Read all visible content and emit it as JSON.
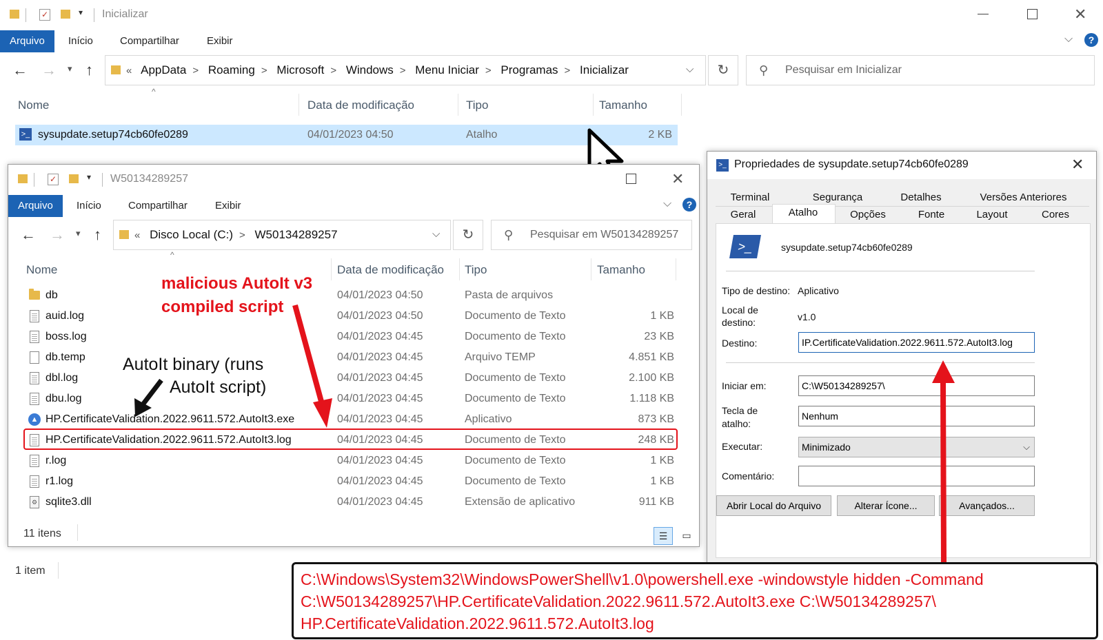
{
  "win1": {
    "title": "Inicializar",
    "ribbon": [
      "Arquivo",
      "Início",
      "Compartilhar",
      "Exibir"
    ],
    "crumbs": [
      "AppData",
      "Roaming",
      "Microsoft",
      "Windows",
      "Menu Iniciar",
      "Programas",
      "Inicializar"
    ],
    "search_placeholder": "Pesquisar em Inicializar",
    "columns": [
      "Nome",
      "Data de modificação",
      "Tipo",
      "Tamanho"
    ],
    "row": {
      "name": "sysupdate.setup74cb60fe0289",
      "date": "04/01/2023 04:50",
      "type": "Atalho",
      "size": "2 KB"
    },
    "status": "1 item"
  },
  "win2": {
    "title": "W50134289257",
    "ribbon": [
      "Arquivo",
      "Início",
      "Compartilhar",
      "Exibir"
    ],
    "crumbs": [
      "Disco Local (C:)",
      "W50134289257"
    ],
    "search_placeholder": "Pesquisar em W50134289257",
    "columns": [
      "Nome",
      "Data de modificação",
      "Tipo",
      "Tamanho"
    ],
    "rows": [
      {
        "name": "db",
        "date": "04/01/2023 04:50",
        "type": "Pasta de arquivos",
        "size": "",
        "icon": "folder-icon"
      },
      {
        "name": "auid.log",
        "date": "04/01/2023 04:50",
        "type": "Documento de Texto",
        "size": "1 KB",
        "icon": "text-file-icon"
      },
      {
        "name": "boss.log",
        "date": "04/01/2023 04:45",
        "type": "Documento de Texto",
        "size": "23 KB",
        "icon": "text-file-icon"
      },
      {
        "name": "db.temp",
        "date": "04/01/2023 04:45",
        "type": "Arquivo TEMP",
        "size": "4.851 KB",
        "icon": "blank-file-icon"
      },
      {
        "name": "dbl.log",
        "date": "04/01/2023 04:45",
        "type": "Documento de Texto",
        "size": "2.100 KB",
        "icon": "text-file-icon"
      },
      {
        "name": "dbu.log",
        "date": "04/01/2023 04:45",
        "type": "Documento de Texto",
        "size": "1.118 KB",
        "icon": "text-file-icon"
      },
      {
        "name": "HP.CertificateValidation.2022.9611.572.AutoIt3.exe",
        "date": "04/01/2023 04:45",
        "type": "Aplicativo",
        "size": "873 KB",
        "icon": "autoit-exe-icon"
      },
      {
        "name": "HP.CertificateValidation.2022.9611.572.AutoIt3.log",
        "date": "04/01/2023 04:45",
        "type": "Documento de Texto",
        "size": "248 KB",
        "icon": "text-file-icon"
      },
      {
        "name": "r.log",
        "date": "04/01/2023 04:45",
        "type": "Documento de Texto",
        "size": "1 KB",
        "icon": "text-file-icon"
      },
      {
        "name": "r1.log",
        "date": "04/01/2023 04:45",
        "type": "Documento de Texto",
        "size": "1 KB",
        "icon": "text-file-icon"
      },
      {
        "name": "sqlite3.dll",
        "date": "04/01/2023 04:45",
        "type": "Extensão de aplicativo",
        "size": "911 KB",
        "icon": "dll-file-icon"
      }
    ],
    "status": "11 itens"
  },
  "dialog": {
    "title": "Propriedades de sysupdate.setup74cb60fe0289",
    "tabs_top": [
      "Terminal",
      "Segurança",
      "Detalhes",
      "Versões Anteriores"
    ],
    "tabs_bottom": [
      "Geral",
      "Atalho",
      "Opções",
      "Fonte",
      "Layout",
      "Cores"
    ],
    "filename": "sysupdate.setup74cb60fe0289",
    "target_type_label": "Tipo de destino:",
    "target_type_value": "Aplicativo",
    "target_location_label_1": "Local de",
    "target_location_label_2": "destino:",
    "target_location_value": "v1.0",
    "target_label": "Destino:",
    "target_value": "IP.CertificateValidation.2022.9611.572.AutoIt3.log",
    "start_in_label": "Iniciar em:",
    "start_in_value": "C:\\W50134289257\\",
    "hotkey_label_1": "Tecla de",
    "hotkey_label_2": "atalho:",
    "hotkey_value": "Nenhum",
    "run_label": "Executar:",
    "run_value": "Minimizado",
    "comment_label": "Comentário:",
    "comment_value": "",
    "btn_open_location": "Abrir Local do Arquivo",
    "btn_change_icon": "Alterar Ícone...",
    "btn_advanced": "Avançados..."
  },
  "annotations": {
    "malicious_1": "malicious AutoIt v3",
    "malicious_2": "compiled script",
    "binary_1": "AutoIt binary (runs",
    "binary_2": "AutoIt script)",
    "cmd_1": "C:\\Windows\\System32\\WindowsPowerShell\\v1.0\\powershell.exe  -windowstyle hidden -Command",
    "cmd_2": "C:\\W50134289257\\HP.CertificateValidation.2022.9611.572.AutoIt3.exe C:\\W50134289257\\",
    "cmd_3": "HP.CertificateValidation.2022.9611.572.AutoIt3.log"
  },
  "colors": {
    "accent": "#1c63b4",
    "annotation_red": "#e4131b",
    "selection": "#cce8ff"
  }
}
